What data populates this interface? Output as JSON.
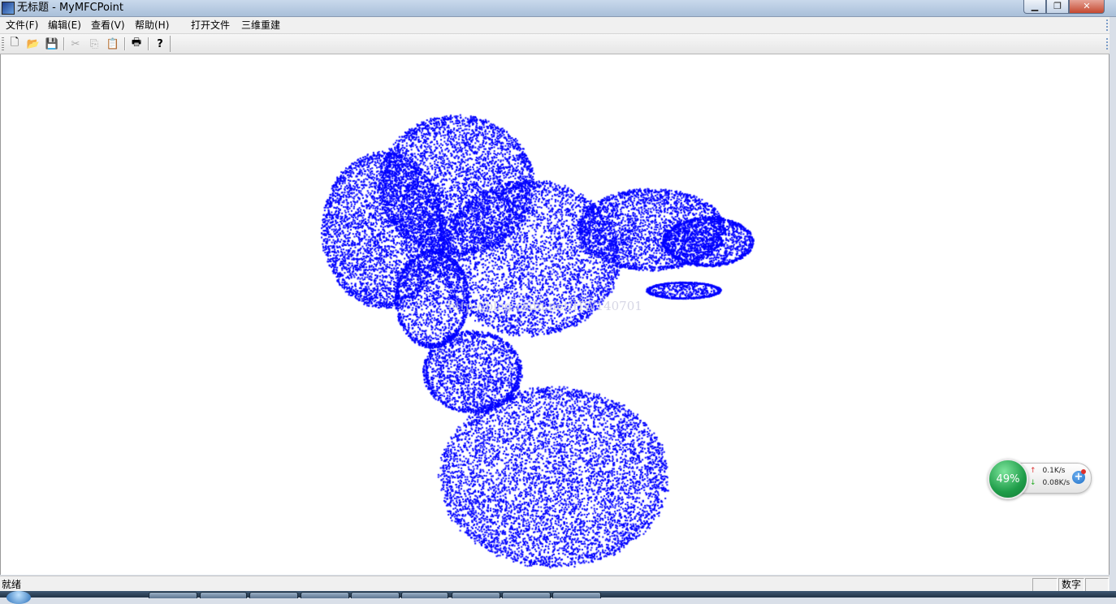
{
  "window": {
    "title": "无标题 - MyMFCPoint",
    "app_icon": "mfc-app-icon",
    "buttons": {
      "minimize": "minimize-icon",
      "restore": "restore-icon",
      "close": "close-icon"
    }
  },
  "menu": {
    "items": [
      {
        "label": "文件(F)"
      },
      {
        "label": "编辑(E)"
      },
      {
        "label": "查看(V)"
      },
      {
        "label": "帮助(H)"
      },
      {
        "label": "打开文件"
      },
      {
        "label": "三维重建"
      }
    ]
  },
  "toolbar": {
    "buttons": [
      {
        "icon": "new-file-icon",
        "glyph": "🗋"
      },
      {
        "icon": "open-folder-icon",
        "glyph": "📂"
      },
      {
        "icon": "save-icon",
        "glyph": "💾"
      },
      {
        "icon": "cut-icon",
        "glyph": "✂"
      },
      {
        "icon": "copy-icon",
        "glyph": "⎘"
      },
      {
        "icon": "paste-icon",
        "glyph": "📋"
      },
      {
        "icon": "print-icon",
        "glyph": "🖶"
      },
      {
        "icon": "help-icon",
        "glyph": "?"
      }
    ]
  },
  "view": {
    "background": "#ffffff",
    "point_color": "#0000ff",
    "watermark": "http://blog.csdn.net/HW140701"
  },
  "network_widget": {
    "percent": "49%",
    "upload": "0.1K/s",
    "download": "0.08K/s",
    "ball_color": "#22a04c"
  },
  "statusbar": {
    "text": "就绪",
    "indicator_num": "数字"
  }
}
